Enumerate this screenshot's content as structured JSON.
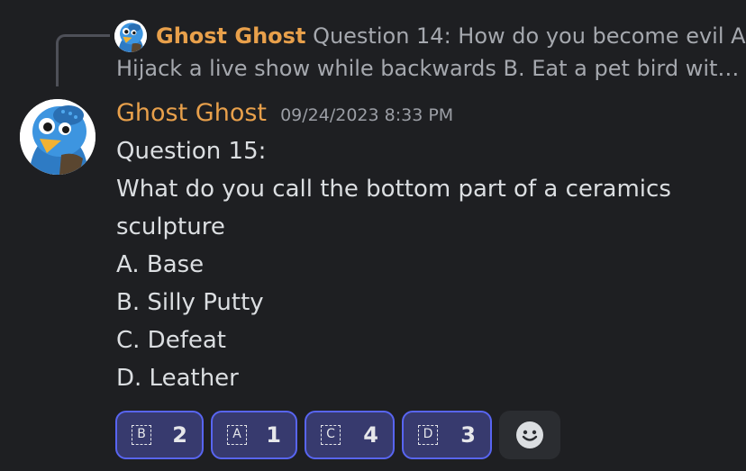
{
  "reply": {
    "author": "Ghost Ghost",
    "text_line1": "Question 14: How do you become evil A.",
    "text_line2": "Hijack a live show while backwards B. Eat a pet bird wit…"
  },
  "message": {
    "author": "Ghost Ghost",
    "timestamp": "09/24/2023 8:33 PM",
    "lines": [
      "Question 15:",
      "What do you call the bottom part of a ceramics",
      "sculpture",
      "A. Base",
      "B. Silly Putty",
      "C. Defeat",
      "D. Leather"
    ]
  },
  "reactions": [
    {
      "emoji": "B",
      "count": "2"
    },
    {
      "emoji": "A",
      "count": "1"
    },
    {
      "emoji": "C",
      "count": "4"
    },
    {
      "emoji": "D",
      "count": "3"
    }
  ],
  "add_reaction_icon": "smiley-face-icon",
  "colors": {
    "background": "#1e1f22",
    "author": "#e8a04b",
    "reaction_bg": "#373a6e",
    "reaction_border": "#5865f2"
  }
}
